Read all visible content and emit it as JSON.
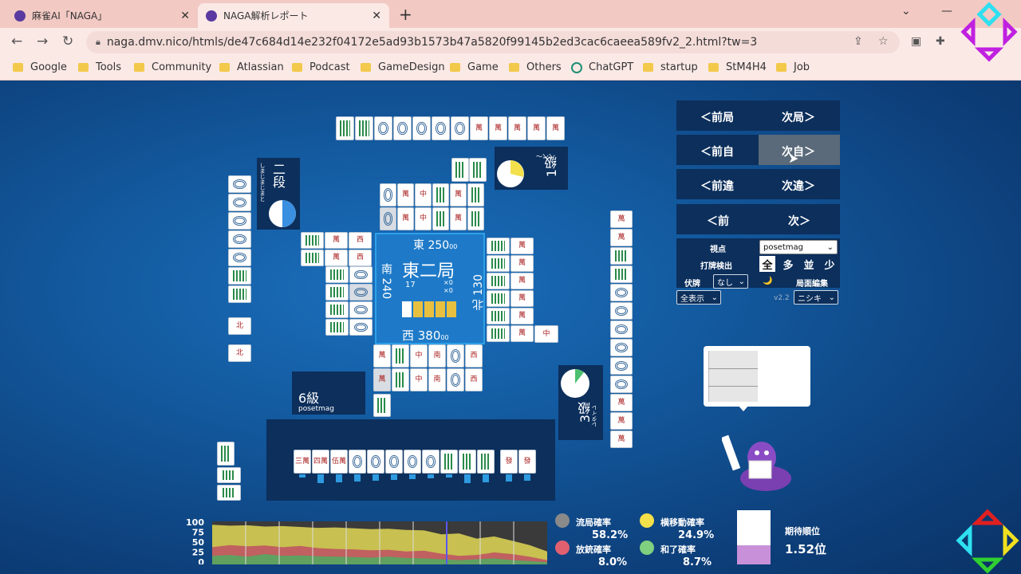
{
  "browser": {
    "tabs": [
      {
        "title": "麻雀AI「NAGA」",
        "active": false
      },
      {
        "title": "NAGA解析レポート",
        "active": true
      }
    ],
    "url": "naga.dmv.nico/htmls/de47c684d14e232f04172e5ad93b1573b47a5820f99145b2ed3cac6caeea589fv2_2.html?tw=3",
    "bookmarks": [
      "Google",
      "Tools",
      "Community",
      "Atlassian",
      "Podcast",
      "GameDesign",
      "Game",
      "Others",
      "ChatGPT",
      "startup",
      "StM4H4",
      "Job"
    ]
  },
  "nav": {
    "prev_round": "＜前局",
    "next_round": "次局＞",
    "prev_self": "＜前自",
    "next_self": "次自＞",
    "prev_diff": "＜前違",
    "next_diff": "次違＞",
    "prev": "＜前",
    "next": "次＞"
  },
  "controls": {
    "viewpoint_label": "視点",
    "viewpoint_value": "posetmag",
    "discard_label": "打牌検出",
    "discard_options": [
      "全",
      "多",
      "並",
      "少"
    ],
    "hidden_label": "伏牌",
    "hidden_value": "なし",
    "moon": "🌙",
    "edit_label": "局面編集",
    "display_value": "全表示",
    "version": "v2.2",
    "model_value": "ニシキ"
  },
  "table": {
    "round": "東二局",
    "honba": "17",
    "east_score": "東 250",
    "south_score": "南 240",
    "west_score": "西 380",
    "north_score": "北 130",
    "score_suffix": "00",
    "counts": [
      "×0",
      "×0"
    ]
  },
  "players": {
    "top": {
      "rank": "1級",
      "name": "ぺぺ〜"
    },
    "left": {
      "rank": "二段",
      "name": "しまじまじまと"
    },
    "right": {
      "rank": "3級",
      "name": "レタイレ"
    },
    "self": {
      "rank": "6級",
      "name": "posetmag"
    }
  },
  "hand": [
    "三萬",
    "四萬",
    "伍萬",
    "p",
    "p",
    "p",
    "p",
    "p",
    "s",
    "s",
    "s",
    "發",
    "發"
  ],
  "stats": {
    "ryukyoku_label": "流局確率",
    "ryukyoku_value": "58.2%",
    "yokoido_label": "横移動確率",
    "yokoido_value": "24.9%",
    "houju_label": "放銃確率",
    "houju_value": "8.0%",
    "agari_label": "和了確率",
    "agari_value": "8.7%",
    "expected_rank_label": "期待順位",
    "expected_rank_value": "1.52位"
  },
  "chart_data": {
    "type": "area",
    "yticks": [
      "100",
      "75",
      "50",
      "25",
      "0"
    ],
    "ylim": [
      0,
      100
    ],
    "series": [
      {
        "values": [
          92,
          90,
          91,
          88,
          89,
          87,
          85,
          86,
          84,
          82,
          83,
          80,
          79,
          70,
          72,
          60,
          65,
          55,
          45,
          30
        ]
      },
      {
        "values": [
          40,
          45,
          42,
          44,
          40,
          43,
          38,
          36,
          35,
          33,
          34,
          30,
          32,
          25,
          20,
          22,
          28,
          24,
          18,
          10
        ]
      },
      {
        "values": [
          20,
          22,
          18,
          24,
          20,
          21,
          19,
          18,
          17,
          16,
          18,
          15,
          14,
          12,
          10,
          12,
          14,
          10,
          8,
          5
        ]
      }
    ]
  }
}
